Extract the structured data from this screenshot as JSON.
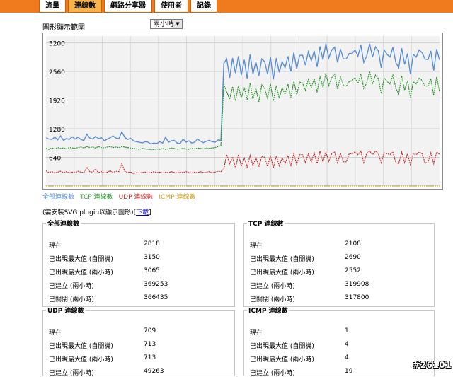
{
  "tabs": [
    {
      "label": "流量",
      "active": false
    },
    {
      "label": "連線數",
      "active": true
    },
    {
      "label": "網路分享器",
      "active": false
    },
    {
      "label": "使用者",
      "active": false
    },
    {
      "label": "記錄",
      "active": false
    }
  ],
  "graph": {
    "label": "圖形顯示範圍",
    "range_select": "兩小時"
  },
  "legend": [
    {
      "label": "全部連線數",
      "color": "#5b8fd6"
    },
    {
      "label": "TCP 連線數",
      "color": "#2e9a2e"
    },
    {
      "label": "UDP 連線數",
      "color": "#c83232"
    },
    {
      "label": "ICMP 連線數",
      "color": "#c8a020"
    }
  ],
  "svg_note": {
    "text": "(需安裝SVG plugin以顯示圖形)",
    "link": "下載"
  },
  "chart_data": {
    "type": "line",
    "y_ticks": [
      "3200",
      "2560",
      "1920",
      "1280",
      "640"
    ],
    "ylim": [
      0,
      3350
    ],
    "grid": true,
    "series": [
      {
        "name": "全部連線數",
        "color": "#5b8fd6",
        "values": [
          1080,
          1050,
          1040,
          1090,
          1030,
          1120,
          1020,
          1060,
          1040,
          1100,
          1050,
          1090,
          1040,
          1020,
          1160,
          1070,
          1050,
          1110,
          1060,
          1080,
          1010,
          1050,
          1080,
          1120,
          1070,
          1060,
          1210,
          1090,
          1040,
          1070,
          1010,
          990,
          980,
          960,
          990,
          980,
          940,
          960,
          950,
          990,
          960,
          1090,
          980,
          1010,
          1020,
          960,
          950,
          1050,
          980,
          1010,
          960,
          980,
          1050,
          1000,
          970,
          1000,
          1020,
          990,
          980,
          1030,
          1020,
          2740,
          2840,
          2420,
          2860,
          2520,
          2900,
          2480,
          2820,
          2400,
          2940,
          2500,
          2780,
          2460,
          2840,
          2780,
          2500,
          2880,
          2380,
          2860,
          2540,
          2780,
          2640,
          2900,
          2560,
          2980,
          2620,
          2920,
          2920,
          2700,
          3000,
          2800,
          3020,
          2660,
          3120,
          2820,
          3180,
          2860,
          3040,
          3100,
          2760,
          3060,
          2840,
          2840,
          2960,
          2960,
          3040,
          2900,
          3150,
          2760,
          2900,
          3180,
          2880,
          3110,
          3020,
          2640,
          3040,
          2940,
          2880,
          3100,
          2760,
          2640,
          3080,
          2720,
          2960,
          2500,
          2940,
          2880,
          3040,
          2980,
          2840,
          2820,
          3020,
          2580,
          3060,
          2818
        ]
      },
      {
        "name": "TCP 連線數",
        "color": "#2e9a2e",
        "values": [
          840,
          820,
          850,
          830,
          860,
          840,
          850,
          830,
          860,
          850,
          840,
          860,
          870,
          850,
          880,
          860,
          870,
          850,
          880,
          860,
          850,
          870,
          880,
          860,
          870,
          860,
          880,
          870,
          860,
          850,
          840,
          830,
          820,
          840,
          830,
          820,
          810,
          820,
          830,
          820,
          840,
          820,
          830,
          850,
          840,
          820,
          830,
          840,
          830,
          820,
          840,
          830,
          850,
          840,
          830,
          850,
          840,
          850,
          860,
          880,
          900,
          2280,
          2100,
          1940,
          2220,
          1900,
          2240,
          1960,
          2200,
          1920,
          2300,
          1940,
          2180,
          1880,
          2260,
          2180,
          1950,
          2280,
          1900,
          2240,
          1960,
          2200,
          2050,
          2280,
          1980,
          2350,
          2040,
          2320,
          2300,
          2140,
          2380,
          2200,
          2400,
          2090,
          2460,
          2200,
          2520,
          2240,
          2420,
          2500,
          2170,
          2440,
          2250,
          2230,
          2330,
          2360,
          2420,
          2290,
          2500,
          2180,
          2300,
          2560,
          2280,
          2480,
          2400,
          2060,
          2420,
          2330,
          2280,
          2480,
          2180,
          2060,
          2460,
          2140,
          2350,
          1980,
          2330,
          2280,
          2420,
          2360,
          2240,
          2230,
          2400,
          2020,
          2440,
          2108
        ]
      },
      {
        "name": "UDP 連線數",
        "color": "#c83232",
        "values": [
          340,
          300,
          320,
          290,
          310,
          330,
          300,
          320,
          290,
          310,
          300,
          330,
          310,
          300,
          420,
          320,
          310,
          380,
          300,
          320,
          290,
          310,
          340,
          300,
          330,
          320,
          500,
          330,
          300,
          310,
          280,
          300,
          290,
          300,
          310,
          290,
          300,
          320,
          300,
          310,
          290,
          310,
          300,
          320,
          300,
          290,
          310,
          300,
          320,
          300,
          290,
          310,
          300,
          320,
          300,
          310,
          320,
          290,
          310,
          330,
          320,
          380,
          700,
          500,
          650,
          400,
          700,
          450,
          620,
          420,
          680,
          450,
          640,
          430,
          660,
          640,
          440,
          680,
          410,
          670,
          450,
          630,
          500,
          680,
          460,
          720,
          480,
          700,
          700,
          520,
          720,
          540,
          740,
          500,
          780,
          540,
          760,
          550,
          720,
          760,
          520,
          730,
          540,
          540,
          720,
          720,
          760,
          700,
          780,
          520,
          720,
          780,
          700,
          780,
          720,
          520,
          740,
          720,
          700,
          760,
          520,
          500,
          760,
          520,
          720,
          480,
          720,
          700,
          760,
          720,
          520,
          520,
          740,
          500,
          760,
          709
        ]
      },
      {
        "name": "ICMP 連線數",
        "color": "#c8a020",
        "values": [
          1,
          1,
          1,
          1,
          1,
          1,
          1,
          1,
          1,
          1,
          1,
          1,
          1,
          1,
          1,
          1,
          1,
          1,
          1,
          1,
          1,
          1,
          1,
          1,
          1,
          1,
          1,
          1,
          1,
          1,
          1,
          1,
          1,
          1,
          1,
          1,
          1,
          1,
          1,
          1,
          1,
          1,
          1,
          1,
          1,
          1,
          1,
          1,
          1,
          1,
          1,
          1,
          1,
          1,
          1,
          1,
          1,
          1,
          1,
          1,
          1,
          1,
          1,
          1,
          1,
          1,
          1,
          1,
          1,
          1,
          1,
          1,
          1,
          1,
          1,
          1,
          1,
          1,
          1,
          1,
          1,
          1,
          1,
          1,
          1,
          1,
          1,
          1,
          1,
          1,
          1,
          1,
          1,
          1,
          1,
          1,
          1,
          1,
          1,
          1,
          1,
          1,
          1,
          1,
          1,
          1,
          1,
          1,
          1,
          1,
          1,
          1,
          1,
          1,
          1,
          1,
          1,
          1,
          1,
          1,
          1,
          1,
          1,
          1,
          1,
          1,
          1,
          1,
          1,
          1,
          1,
          1,
          1,
          1,
          1,
          1,
          1,
          1,
          1,
          1
        ]
      }
    ]
  },
  "stats": {
    "all": {
      "title": "全部連線數",
      "rows": [
        {
          "label": "現在",
          "value": "2818"
        },
        {
          "label": "已出現最大值 (自開機)",
          "value": "3150"
        },
        {
          "label": "已出現最大值 (兩小時)",
          "value": "3065"
        },
        {
          "label": "已建立 (兩小時)",
          "value": "369253"
        },
        {
          "label": "已關閉 (兩小時)",
          "value": "366435"
        }
      ]
    },
    "tcp": {
      "title": "TCP 連線數",
      "rows": [
        {
          "label": "現在",
          "value": "2108"
        },
        {
          "label": "已出現最大值 (自開機)",
          "value": "2690"
        },
        {
          "label": "已出現最大值 (兩小時)",
          "value": "2552"
        },
        {
          "label": "已建立 (兩小時)",
          "value": "319908"
        },
        {
          "label": "已關閉 (兩小時)",
          "value": "317800"
        }
      ]
    },
    "udp": {
      "title": "UDP 連線數",
      "rows": [
        {
          "label": "現在",
          "value": "709"
        },
        {
          "label": "已出現最大值 (自開機)",
          "value": "713"
        },
        {
          "label": "已出現最大值 (兩小時)",
          "value": "713"
        },
        {
          "label": "已建立 (兩小時)",
          "value": "49263"
        }
      ]
    },
    "icmp": {
      "title": "ICMP 連線數",
      "rows": [
        {
          "label": "現在",
          "value": "1"
        },
        {
          "label": "已出現最大值 (自開機)",
          "value": "4"
        },
        {
          "label": "已出現最大值 (兩小時)",
          "value": "4"
        },
        {
          "label": "已建立 (兩小時)",
          "value": "19"
        }
      ]
    }
  },
  "watermark": "#26101"
}
